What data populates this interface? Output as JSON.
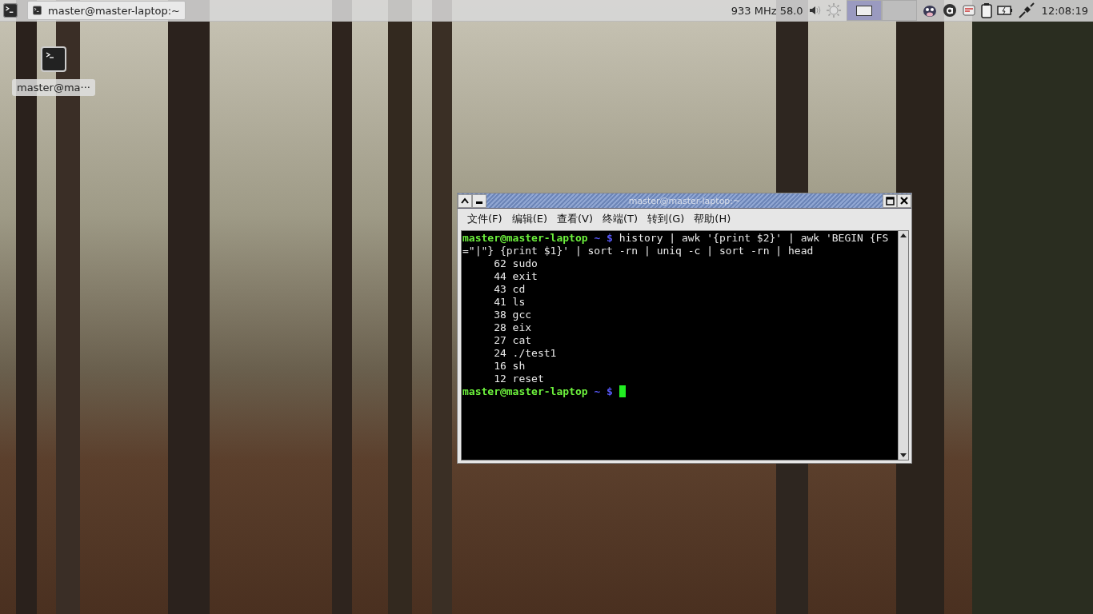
{
  "panel": {
    "taskbar": [
      {
        "title": "master@master-laptop:~"
      }
    ],
    "cpu_status": "933 MHz 58.0",
    "workspaces": [
      {
        "selected": true
      },
      {
        "selected": false
      }
    ],
    "clock": "12:08:19"
  },
  "desktop_icons": [
    {
      "label": "master@ma···"
    }
  ],
  "terminal": {
    "title": "master@master-laptop:~",
    "menu": [
      "文件(F)",
      "编辑(E)",
      "查看(V)",
      "终端(T)",
      "转到(G)",
      "帮助(H)"
    ],
    "lines": [
      {
        "kind": "prompt",
        "user": "master@master-laptop",
        "path": "~",
        "symbol": "$",
        "command": "history | awk '{print $2}' | awk 'BEGIN {FS=\"|\"} {print $1}' | sort -rn | uniq -c | sort -rn | head",
        "cursor": false
      },
      {
        "kind": "output",
        "text": "62 sudo"
      },
      {
        "kind": "output",
        "text": "44 exit"
      },
      {
        "kind": "output",
        "text": "43 cd"
      },
      {
        "kind": "output",
        "text": "41 ls"
      },
      {
        "kind": "output",
        "text": "38 gcc"
      },
      {
        "kind": "output",
        "text": "28 eix"
      },
      {
        "kind": "output",
        "text": "27 cat"
      },
      {
        "kind": "output",
        "text": "24 ./test1"
      },
      {
        "kind": "output",
        "text": "16 sh"
      },
      {
        "kind": "output",
        "text": "12 reset"
      },
      {
        "kind": "prompt",
        "user": "master@master-laptop",
        "path": "~",
        "symbol": "$",
        "cursor": true
      }
    ]
  }
}
